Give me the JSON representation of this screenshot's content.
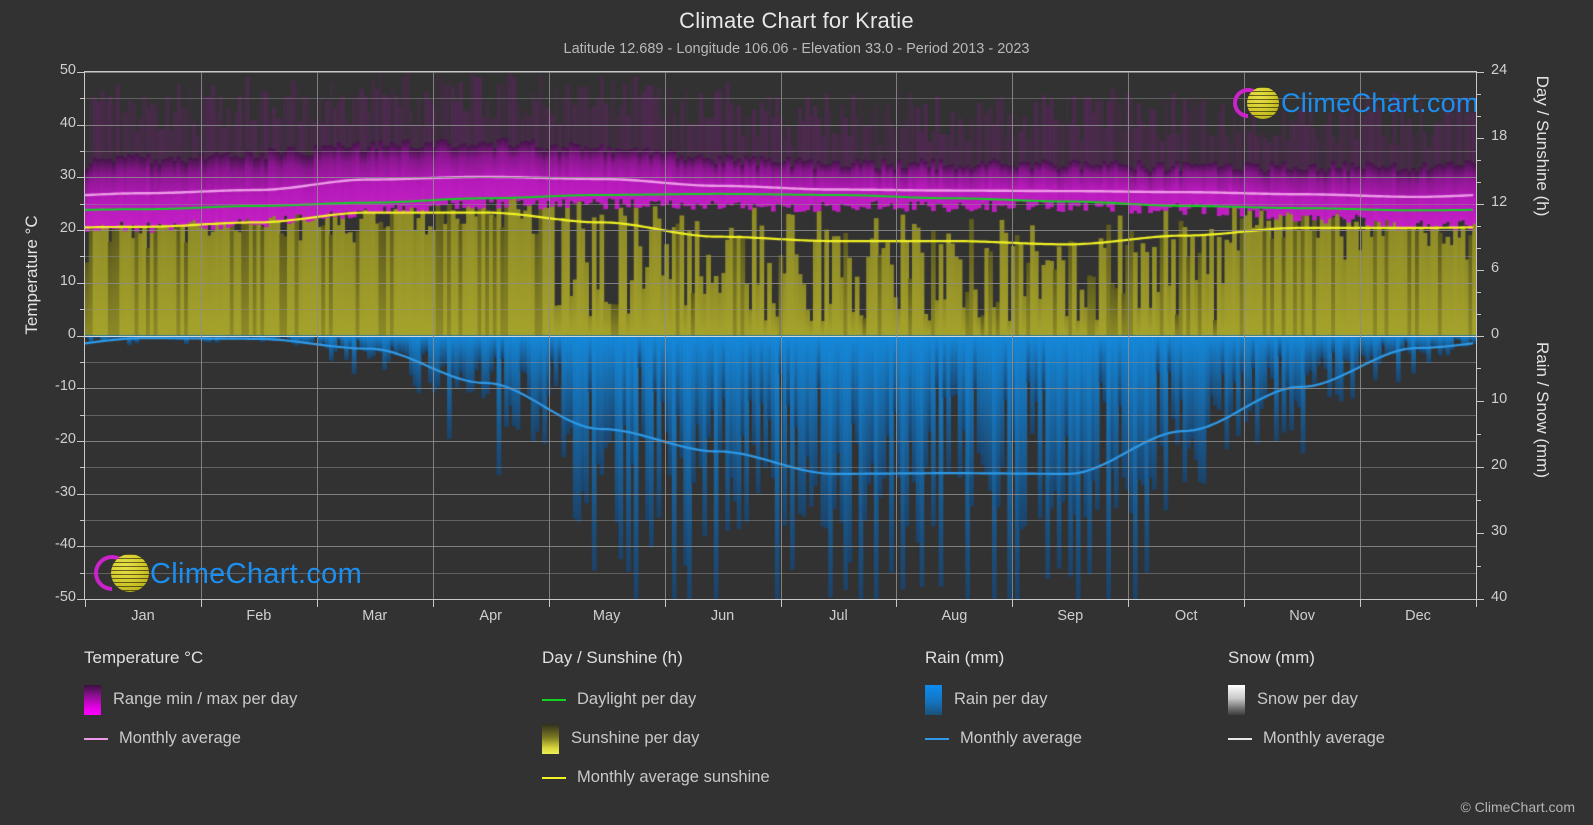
{
  "header": {
    "title": "Climate Chart for Kratie",
    "subtitle": "Latitude 12.689 - Longitude 106.06 - Elevation 33.0 - Period 2013 - 2023"
  },
  "watermark": {
    "text": "ClimeChart.com",
    "arc_color": "#cc22cc",
    "ball_color": "#d4cc2e",
    "text_color": "#1b8ff0"
  },
  "copyright": "© ClimeChart.com",
  "axes": {
    "left": {
      "title": "Temperature °C",
      "ticks": [
        "50",
        "40",
        "30",
        "20",
        "10",
        "0",
        "-10",
        "-20",
        "-30",
        "-40",
        "-50"
      ],
      "min": -50,
      "max": 50,
      "step": 10
    },
    "right_top": {
      "title": "Day / Sunshine (h)",
      "ticks": [
        "24",
        "18",
        "12",
        "6",
        "0"
      ],
      "min": 0,
      "max": 24,
      "step": 6
    },
    "right_bottom": {
      "title": "Rain / Snow (mm)",
      "ticks": [
        "0",
        "10",
        "20",
        "30",
        "40"
      ],
      "min": 0,
      "max": 40,
      "step": 10
    },
    "x": {
      "ticks": [
        "Jan",
        "Feb",
        "Mar",
        "Apr",
        "May",
        "Jun",
        "Jul",
        "Aug",
        "Sep",
        "Oct",
        "Nov",
        "Dec"
      ]
    }
  },
  "legend": {
    "columns": [
      {
        "heading": "Temperature °C",
        "items": [
          {
            "label": "Range min / max per day",
            "marker": "box",
            "style": "sw-temp-range"
          },
          {
            "label": "Monthly average",
            "marker": "line",
            "color": "#ee9ae8"
          }
        ]
      },
      {
        "heading": "Day / Sunshine (h)",
        "items": [
          {
            "label": "Daylight per day",
            "marker": "line",
            "color": "#12d320"
          },
          {
            "label": "Sunshine per day",
            "marker": "box",
            "style": "sw-sunshine"
          },
          {
            "label": "Monthly average sunshine",
            "marker": "line",
            "color": "#f2f225"
          }
        ]
      },
      {
        "heading": "Rain (mm)",
        "items": [
          {
            "label": "Rain per day",
            "marker": "box",
            "style": "sw-rain"
          },
          {
            "label": "Monthly average",
            "marker": "line",
            "color": "#2e9ae8"
          }
        ]
      },
      {
        "heading": "Snow (mm)",
        "items": [
          {
            "label": "Snow per day",
            "marker": "box",
            "style": "sw-snow"
          },
          {
            "label": "Monthly average",
            "marker": "line",
            "color": "#e6e6e6"
          }
        ]
      }
    ]
  },
  "chart_data": {
    "type": "area",
    "title": "Climate Chart for Kratie",
    "subtitle": "Latitude 12.689 - Longitude 106.06 - Elevation 33.0 - Period 2013 - 2023",
    "xlabel": "",
    "ylabel": "Temperature °C",
    "ylim": [
      -50,
      50
    ],
    "y2lim_day_sunshine": [
      0,
      24
    ],
    "y2lim_rain_snow": [
      0,
      40
    ],
    "grid": true,
    "legend_position": "below",
    "categories": [
      "Jan",
      "Feb",
      "Mar",
      "Apr",
      "May",
      "Jun",
      "Jul",
      "Aug",
      "Sep",
      "Oct",
      "Nov",
      "Dec"
    ],
    "series": [
      {
        "name": "Temperature monthly average",
        "unit": "°C",
        "color": "#ee9ae8",
        "axis": "left",
        "values": [
          27.0,
          27.6,
          29.6,
          30.1,
          29.7,
          28.4,
          27.7,
          27.5,
          27.4,
          27.2,
          26.8,
          26.3
        ]
      },
      {
        "name": "Temperature daily max (range top)",
        "unit": "°C",
        "color": "#d400d4",
        "axis": "left",
        "values": [
          33.5,
          34.5,
          36.0,
          36.5,
          35.5,
          33.5,
          32.5,
          32.5,
          32.5,
          32.0,
          32.0,
          32.0
        ]
      },
      {
        "name": "Temperature daily min (range bottom)",
        "unit": "°C",
        "color": "#8b1090",
        "axis": "left",
        "values": [
          20.5,
          21.5,
          23.5,
          25.0,
          25.0,
          24.5,
          24.5,
          24.5,
          24.5,
          24.0,
          22.5,
          21.0
        ]
      },
      {
        "name": "Daylight per day",
        "unit": "h",
        "color": "#12d320",
        "axis": "right_top",
        "values": [
          11.5,
          11.8,
          12.1,
          12.5,
          12.8,
          12.9,
          12.8,
          12.5,
          12.2,
          11.8,
          11.6,
          11.4
        ]
      },
      {
        "name": "Monthly average sunshine",
        "unit": "h",
        "color": "#f2f225",
        "axis": "right_top",
        "values": [
          9.9,
          10.3,
          11.2,
          11.2,
          10.3,
          9.0,
          8.6,
          8.6,
          8.3,
          9.1,
          9.8,
          9.8
        ]
      },
      {
        "name": "Rain monthly average",
        "unit": "mm",
        "color": "#2e9ae8",
        "axis": "right_bottom",
        "values": [
          0.4,
          0.5,
          2.0,
          7.2,
          14.2,
          17.6,
          21.0,
          20.9,
          21.0,
          14.5,
          7.8,
          1.9
        ]
      },
      {
        "name": "Snow monthly average",
        "unit": "mm",
        "color": "#e6e6e6",
        "axis": "right_bottom",
        "values": [
          0,
          0,
          0,
          0,
          0,
          0,
          0,
          0,
          0,
          0,
          0,
          0
        ]
      }
    ]
  }
}
